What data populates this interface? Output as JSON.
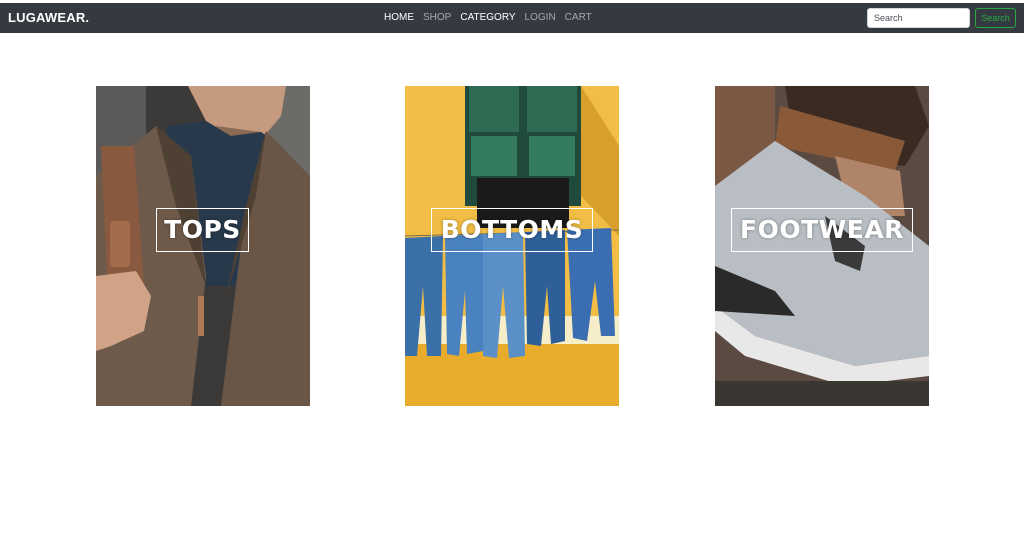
{
  "navbar": {
    "brand": "LUGAWEAR.",
    "links": [
      {
        "label": "HOME",
        "active": true
      },
      {
        "label": "SHOP",
        "active": false
      },
      {
        "label": "CATEGORY",
        "active": false
      },
      {
        "label": "LOGIN",
        "active": false
      },
      {
        "label": "CART",
        "active": false
      }
    ],
    "search": {
      "placeholder": "Search",
      "button_label": "Search"
    }
  },
  "categories": [
    {
      "label": "TOPS",
      "image": "man-in-tweed-jacket-photo"
    },
    {
      "label": "BOTTOMS",
      "image": "jeans-on-clothesline-photo"
    },
    {
      "label": "FOOTWEAR",
      "image": "grey-sneaker-photo"
    }
  ],
  "colors": {
    "navbar_bg": "#343a40",
    "search_accent": "#28a745",
    "page_bg": "#ffffff"
  }
}
